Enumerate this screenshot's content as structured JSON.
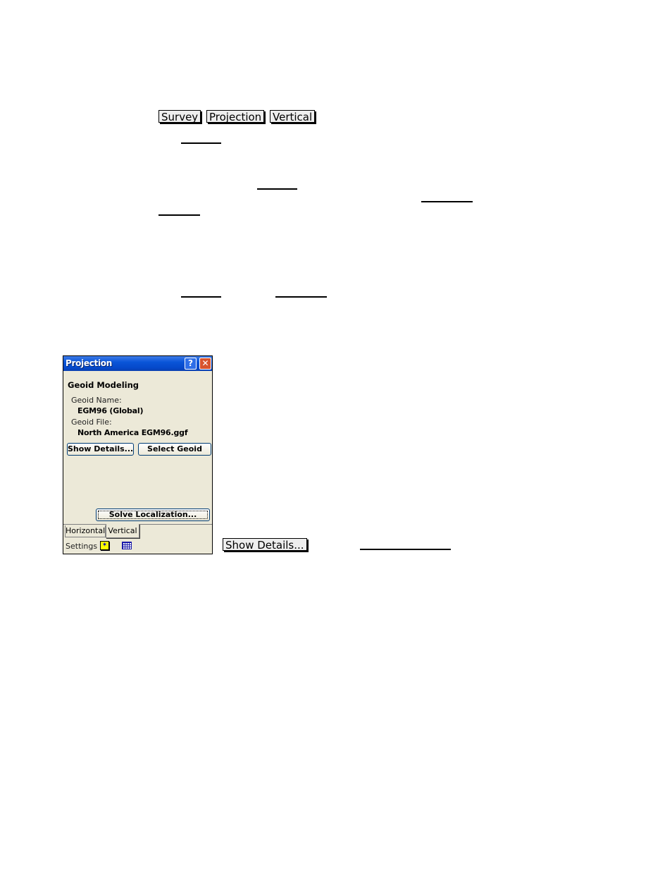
{
  "tab_buttons": [
    "Survey",
    "Projection",
    "Vertical"
  ],
  "window": {
    "title": "Projection",
    "help_glyph": "?",
    "close_glyph": "✕",
    "section_title": "Geoid Modeling",
    "geoid_name_label": "Geoid Name:",
    "geoid_name_value": "EGM96 (Global)",
    "geoid_file_label": "Geoid File:",
    "geoid_file_value": "North America EGM96.ggf",
    "show_details_button": "Show Details...",
    "select_geoid_button": "Select Geoid",
    "solve_localization_button": "Solve Localization...",
    "tabs": [
      "Horizontal",
      "Vertical"
    ],
    "active_tab": "Vertical",
    "status_label": "Settings",
    "star_glyph": "✶"
  },
  "callout_button": "Show Details..."
}
